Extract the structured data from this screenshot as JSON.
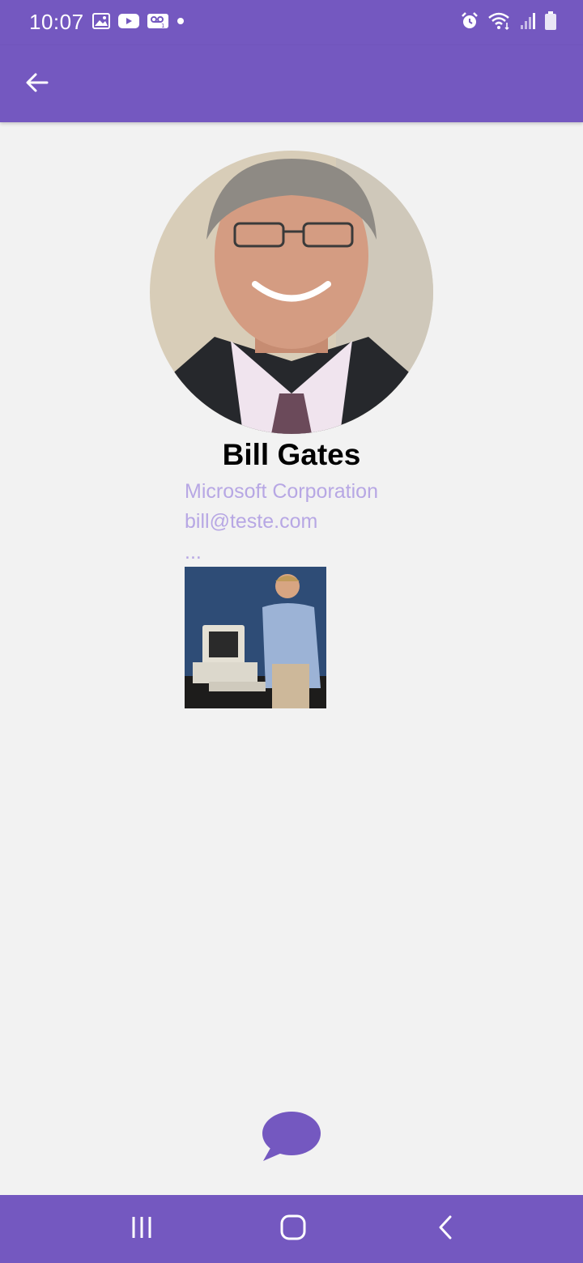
{
  "status_bar": {
    "time": "10:07",
    "left_icons": [
      "gallery-icon",
      "youtube-icon",
      "voicemail-icon",
      "dot-icon"
    ],
    "right_icons": [
      "alarm-icon",
      "wifi-icon",
      "signal-icon",
      "battery-icon"
    ]
  },
  "app_bar": {
    "back_icon": "arrow-left-icon"
  },
  "profile": {
    "name": "Bill Gates",
    "company": "Microsoft Corporation",
    "email": "bill@teste.com",
    "more": "..."
  },
  "actions": {
    "chat_icon": "chat-bubble-icon"
  },
  "nav_bar": {
    "items": [
      "recents-icon",
      "home-icon",
      "back-icon"
    ]
  },
  "colors": {
    "primary": "#7458c0",
    "background": "#f2f2f2",
    "secondary_text": "#b7a7e4"
  }
}
